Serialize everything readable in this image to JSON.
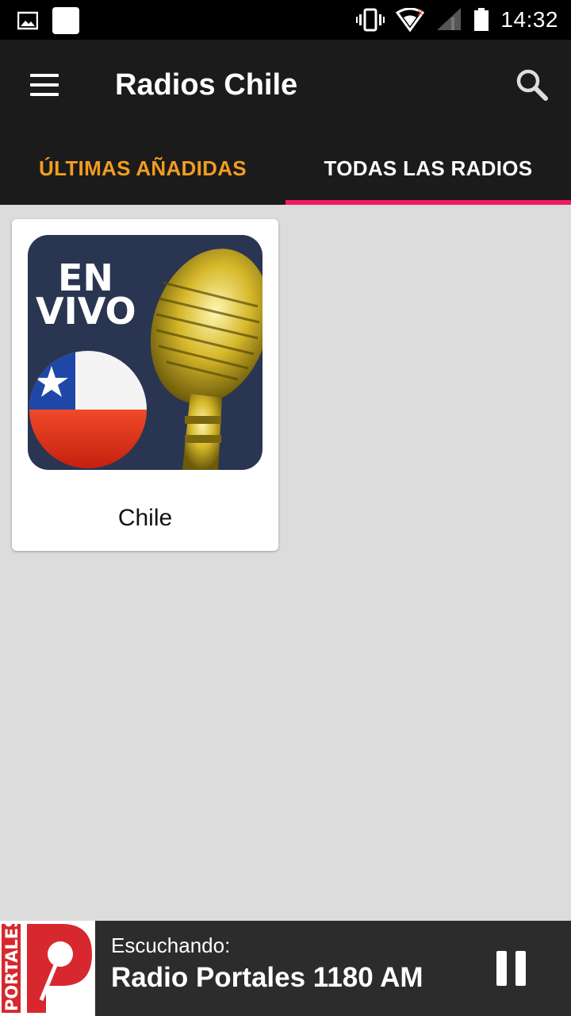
{
  "status_bar": {
    "time": "14:32",
    "icons": [
      "image-icon",
      "white-square-icon",
      "vibrate-icon",
      "wifi-icon",
      "signal-icon",
      "battery-icon"
    ]
  },
  "app_bar": {
    "title": "Radios Chile",
    "menu_icon": "menu-icon",
    "search_icon": "search-icon"
  },
  "tabs": [
    {
      "label": "ÚLTIMAS AÑADIDAS",
      "color": "#f19d21",
      "selected": false
    },
    {
      "label": "TODAS LAS RADIOS",
      "color": "#ffffff",
      "selected": true
    }
  ],
  "accent_color": "#ee1c5e",
  "cards": [
    {
      "label": "Chile",
      "image": {
        "badge_text_line1": "EN",
        "badge_text_line2": "VIVO",
        "icons": [
          "chile-flag-icon",
          "microphone-icon"
        ]
      }
    }
  ],
  "player": {
    "status_label": "Escuchando:",
    "station_name": "Radio Portales 1180 AM",
    "logo_text": "PORTALES",
    "logo_icon": "portales-logo-icon",
    "control_icon": "pause-icon"
  }
}
